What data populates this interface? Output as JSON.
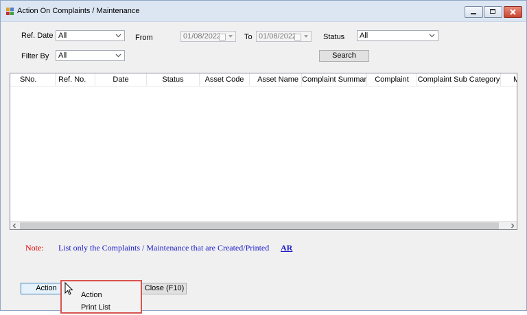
{
  "window": {
    "title": "Action On Complaints / Maintenance"
  },
  "filters": {
    "ref_date_label": "Ref. Date",
    "ref_date_value": "All",
    "from_label": "From",
    "from_value": "01/08/2022",
    "to_label": "To",
    "to_value": "01/08/2022",
    "status_label": "Status",
    "status_value": "All",
    "filter_by_label": "Filter By",
    "filter_by_value": "All",
    "search_label": "Search"
  },
  "grid": {
    "columns": [
      "SNo.",
      "Ref. No.",
      "Date",
      "Status",
      "Asset Code",
      "Asset Name",
      "Complaint Summary",
      "Complaint",
      "Complaint Sub Category",
      "M"
    ]
  },
  "note": {
    "label": "Note:",
    "text": "List only the Complaints / Maintenance that are Created/Printed",
    "link": "AR"
  },
  "buttons": {
    "action": "Action",
    "close": "Close (F10)"
  },
  "context_menu": {
    "items": [
      "Action",
      "Print List"
    ]
  },
  "colors": {
    "note_label": "#e00000",
    "note_text": "#1a1acc",
    "menu_highlight_border": "#d9534f"
  }
}
